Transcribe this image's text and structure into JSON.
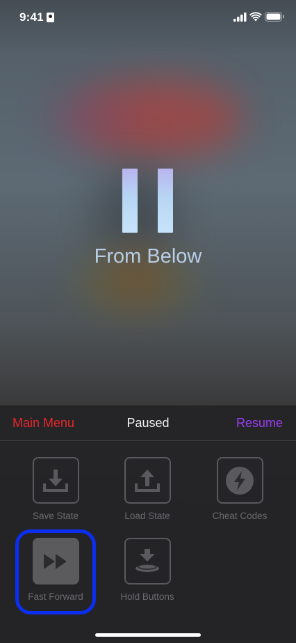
{
  "status_bar": {
    "time": "9:41"
  },
  "game": {
    "title": "From Below"
  },
  "pause_menu": {
    "main_menu_label": "Main Menu",
    "title": "Paused",
    "resume_label": "Resume",
    "items": [
      {
        "label": "Save State",
        "icon": "save-state-icon"
      },
      {
        "label": "Load State",
        "icon": "load-state-icon"
      },
      {
        "label": "Cheat Codes",
        "icon": "lightning-icon"
      },
      {
        "label": "Fast Forward",
        "icon": "fast-forward-icon",
        "selected": true
      },
      {
        "label": "Hold Buttons",
        "icon": "hold-buttons-icon"
      }
    ]
  },
  "colors": {
    "main_menu": "#e8262a",
    "resume": "#9b3df5",
    "focus_ring": "#0b2ef0"
  }
}
